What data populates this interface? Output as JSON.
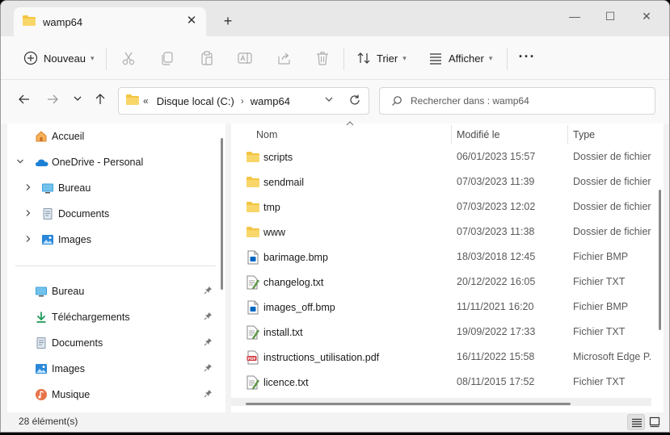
{
  "tab": {
    "title": "wamp64"
  },
  "window_controls": {
    "minimize": "—",
    "maximize": "☐",
    "close": "✕"
  },
  "commands": {
    "new_label": "Nouveau",
    "sort_label": "Trier",
    "view_label": "Afficher"
  },
  "address": {
    "overflow": "«",
    "crumbs": [
      "Disque local (C:)",
      "wamp64"
    ],
    "separator": "›"
  },
  "search": {
    "placeholder": "Rechercher dans : wamp64"
  },
  "sidebar": {
    "items": [
      {
        "label": "Accueil",
        "icon": "home-icon"
      },
      {
        "label": "OneDrive - Personal",
        "icon": "cloud-icon",
        "expanded": true
      },
      {
        "label": "Bureau",
        "icon": "desktop-icon"
      },
      {
        "label": "Documents",
        "icon": "documents-icon"
      },
      {
        "label": "Images",
        "icon": "images-icon"
      }
    ],
    "quick_access": [
      {
        "label": "Bureau",
        "icon": "desktop-icon",
        "pinned": true
      },
      {
        "label": "Téléchargements",
        "icon": "download-icon",
        "pinned": true
      },
      {
        "label": "Documents",
        "icon": "documents-icon",
        "pinned": true
      },
      {
        "label": "Images",
        "icon": "images-icon",
        "pinned": true
      },
      {
        "label": "Musique",
        "icon": "music-icon",
        "pinned": true
      }
    ]
  },
  "columns": {
    "name": "Nom",
    "modified": "Modifié le",
    "type": "Type"
  },
  "files": [
    {
      "name": "scripts",
      "modified": "06/01/2023 15:57",
      "type": "Dossier de fichiers",
      "kind": "folder"
    },
    {
      "name": "sendmail",
      "modified": "07/03/2023 11:39",
      "type": "Dossier de fichiers",
      "kind": "folder"
    },
    {
      "name": "tmp",
      "modified": "07/03/2023 12:02",
      "type": "Dossier de fichiers",
      "kind": "folder"
    },
    {
      "name": "www",
      "modified": "07/03/2023 11:38",
      "type": "Dossier de fichiers",
      "kind": "folder"
    },
    {
      "name": "barimage.bmp",
      "modified": "18/03/2018 12:45",
      "type": "Fichier BMP",
      "kind": "bmp"
    },
    {
      "name": "changelog.txt",
      "modified": "20/12/2022 16:05",
      "type": "Fichier TXT",
      "kind": "txt"
    },
    {
      "name": "images_off.bmp",
      "modified": "11/11/2021 16:20",
      "type": "Fichier BMP",
      "kind": "bmp"
    },
    {
      "name": "install.txt",
      "modified": "19/09/2022 17:33",
      "type": "Fichier TXT",
      "kind": "txt"
    },
    {
      "name": "instructions_utilisation.pdf",
      "modified": "16/11/2022 15:58",
      "type": "Microsoft Edge P...",
      "kind": "pdf"
    },
    {
      "name": "licence.txt",
      "modified": "08/11/2015 17:52",
      "type": "Fichier TXT",
      "kind": "txt"
    }
  ],
  "status": {
    "count": "28 élément(s)"
  },
  "colors": {
    "folder": "#f4c542",
    "accent": "#0067c0",
    "pdf": "#d13438"
  }
}
